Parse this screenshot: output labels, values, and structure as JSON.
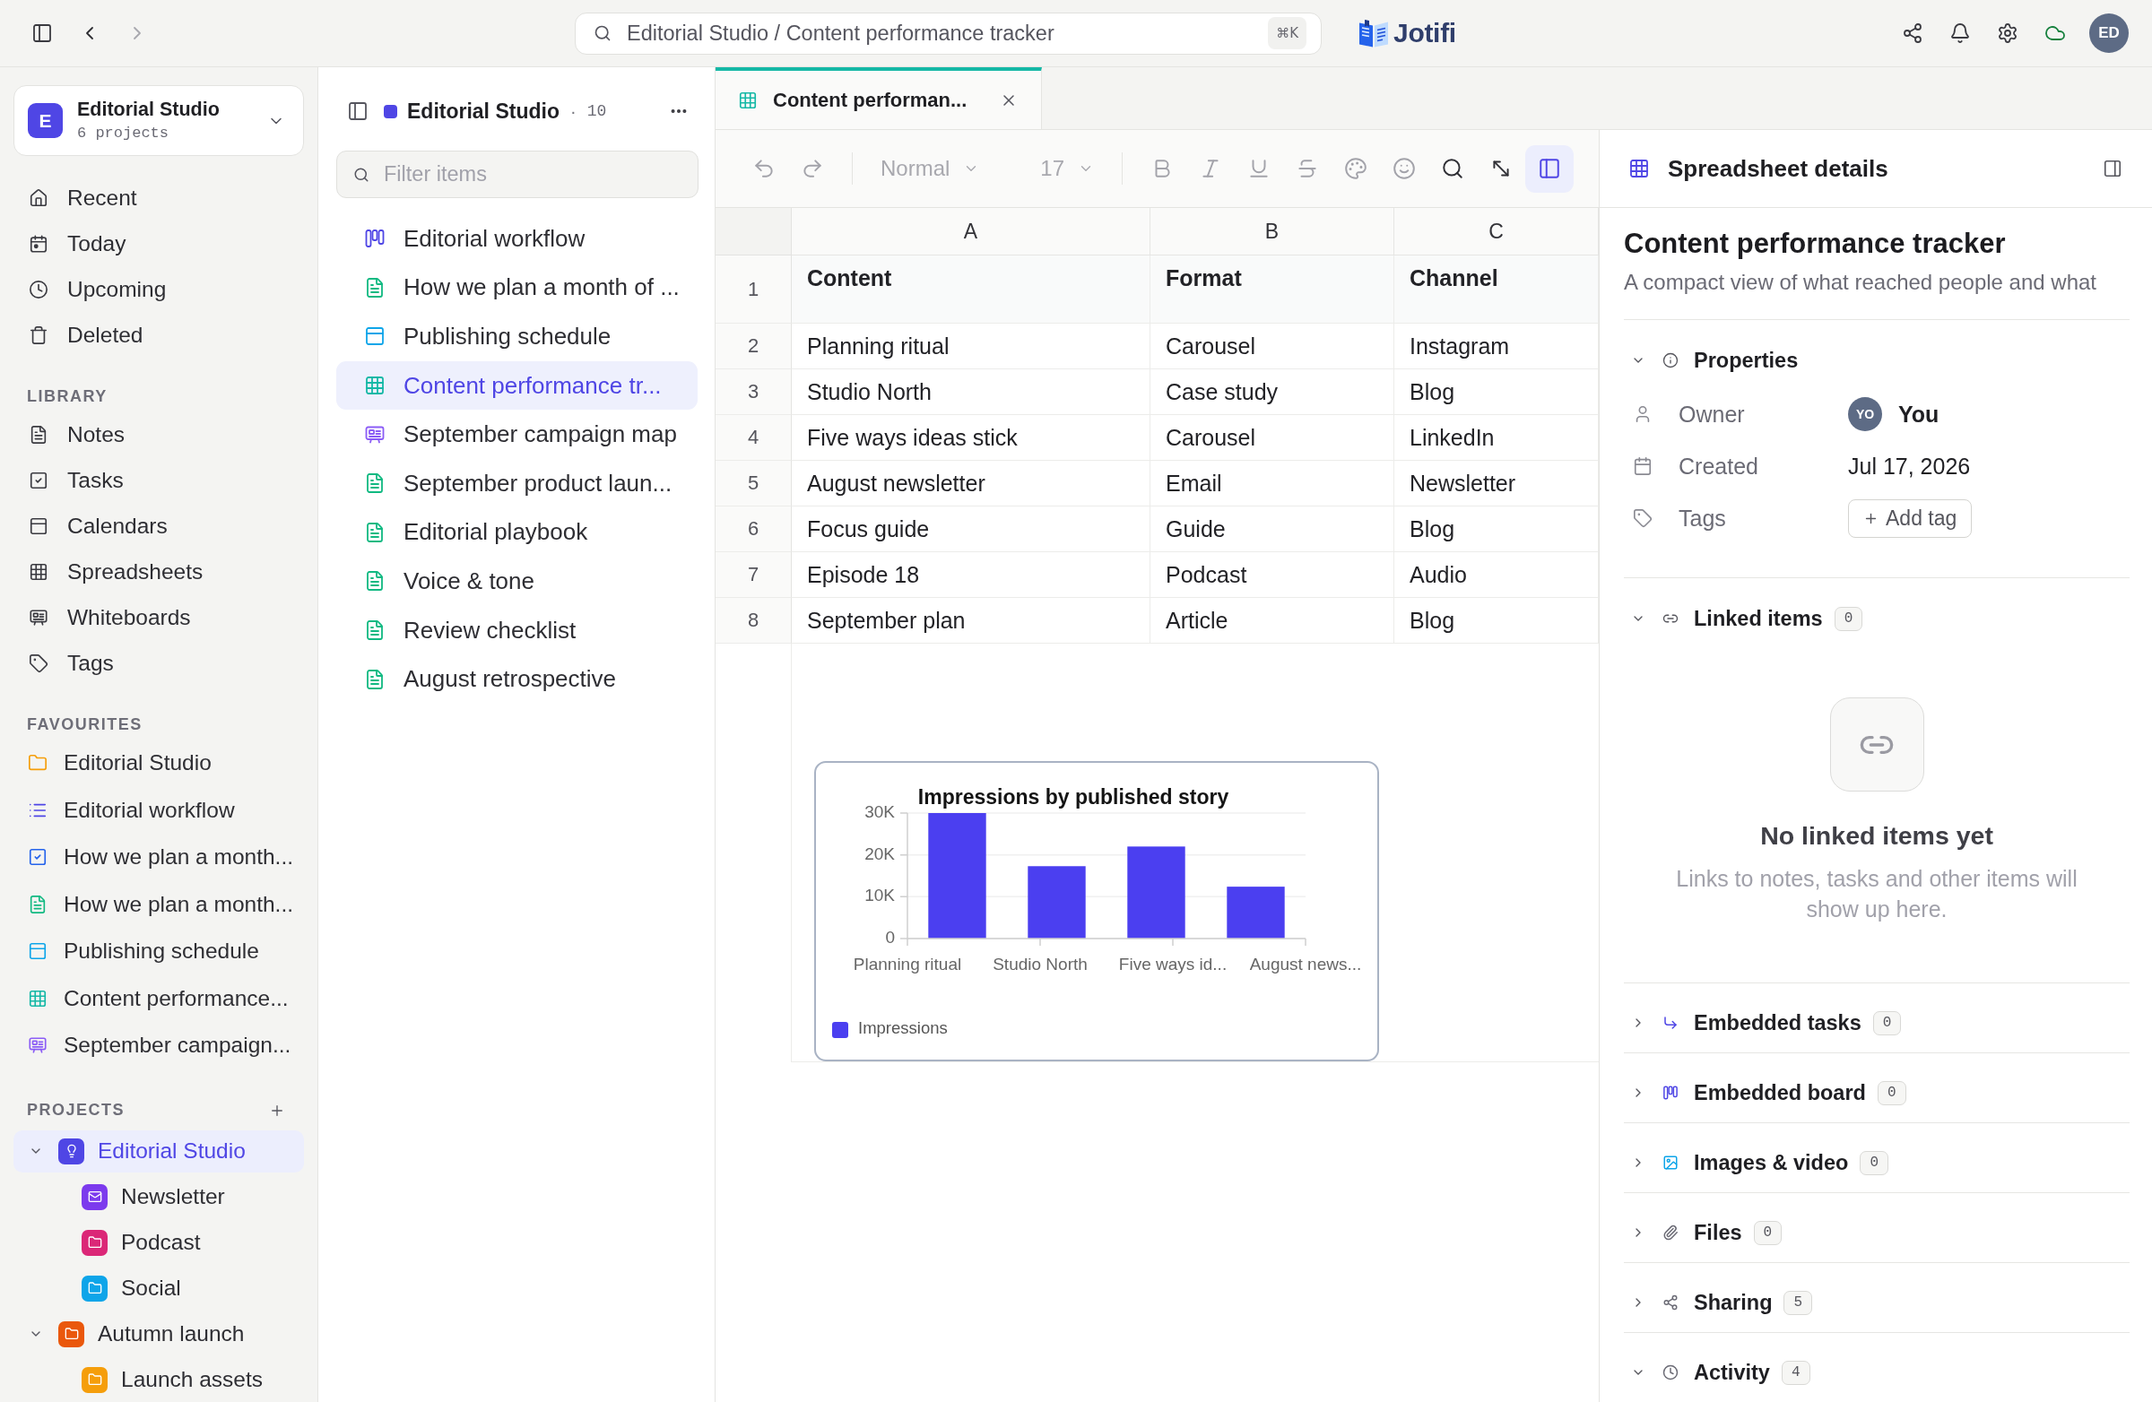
{
  "topbar": {
    "history": [
      {
        "kind": "back",
        "disabled": false
      },
      {
        "kind": "forward",
        "disabled": true
      }
    ],
    "search": {
      "value": "Editorial Studio / Content performance tracker",
      "shortcut": "⌘K"
    },
    "logo": "Jotifi",
    "avatar": "ED"
  },
  "sidebar": {
    "workspace": {
      "initial": "E",
      "name": "Editorial Studio",
      "subtitle": "6 projects"
    },
    "nav": [
      "Recent",
      "Today",
      "Upcoming",
      "Deleted"
    ],
    "library": {
      "title": "LIBRARY",
      "items": [
        "Notes",
        "Tasks",
        "Calendars",
        "Spreadsheets",
        "Whiteboards",
        "Tags"
      ]
    },
    "favourites": {
      "title": "FAVOURITES",
      "items": [
        {
          "label": "Editorial Studio",
          "kind": "folder"
        },
        {
          "label": "Editorial workflow",
          "kind": "list"
        },
        {
          "label": "How we plan a month...",
          "kind": "task"
        },
        {
          "label": "How we plan a month...",
          "kind": "note"
        },
        {
          "label": "Publishing schedule",
          "kind": "calendar"
        },
        {
          "label": "Content performance...",
          "kind": "spreadsheet"
        },
        {
          "label": "September campaign...",
          "kind": "whiteboard"
        }
      ]
    },
    "projects": {
      "title": "PROJECTS",
      "items": [
        {
          "label": "Editorial Studio",
          "kind": "idea",
          "color": "#4f46e5",
          "selected": true,
          "expanded": true,
          "children": [
            {
              "label": "Newsletter",
              "kind": "mail",
              "color": "#7c3aed",
              "selected": false
            },
            {
              "label": "Podcast",
              "kind": "folder",
              "color": "#db2777",
              "selected": false
            },
            {
              "label": "Social",
              "kind": "folder",
              "color": "#0ea5e9",
              "selected": false
            }
          ]
        },
        {
          "label": "Autumn launch",
          "kind": "folder",
          "color": "#ea580c",
          "selected": false,
          "expanded": true,
          "children": [
            {
              "label": "Launch assets",
              "kind": "folder",
              "color": "#f59e0b",
              "selected": false
            }
          ]
        }
      ]
    }
  },
  "collection": {
    "title": "Editorial Studio",
    "separator": "·",
    "count": "10",
    "filter": {
      "placeholder": "Filter items"
    },
    "items": [
      {
        "label": "Editorial workflow",
        "kind": "board",
        "selected": false
      },
      {
        "label": "How we plan a month of ...",
        "kind": "note",
        "selected": false
      },
      {
        "label": "Publishing schedule",
        "kind": "calendar",
        "selected": false
      },
      {
        "label": "Content performance tr...",
        "kind": "spreadsheet",
        "selected": true
      },
      {
        "label": "September campaign map",
        "kind": "whiteboard",
        "selected": false
      },
      {
        "label": "September product laun...",
        "kind": "note",
        "selected": false
      },
      {
        "label": "Editorial playbook",
        "kind": "note",
        "selected": false
      },
      {
        "label": "Voice & tone",
        "kind": "note",
        "selected": false
      },
      {
        "label": "Review checklist",
        "kind": "note",
        "selected": false
      },
      {
        "label": "August retrospective",
        "kind": "note",
        "selected": false
      }
    ]
  },
  "editor": {
    "tabs": [
      {
        "label": "Content performan...",
        "selected": true
      }
    ],
    "toolbar": {
      "history": [
        {
          "kind": "undo",
          "disabled": true
        },
        {
          "kind": "redo",
          "disabled": true
        }
      ],
      "style": {
        "value": "Normal",
        "disabled": true
      },
      "size": {
        "value": "17",
        "disabled": true
      },
      "tools": [
        {
          "kind": "bold",
          "disabled": true,
          "active": false
        },
        {
          "kind": "italic",
          "disabled": true,
          "active": false
        },
        {
          "kind": "underline",
          "disabled": true,
          "active": false
        },
        {
          "kind": "strikethrough",
          "disabled": true,
          "active": false
        },
        {
          "kind": "color",
          "disabled": true,
          "active": false
        },
        {
          "kind": "emoji",
          "disabled": true,
          "active": false
        },
        {
          "kind": "search",
          "disabled": false,
          "active": false
        },
        {
          "kind": "expand",
          "disabled": false,
          "active": false
        },
        {
          "kind": "panel",
          "disabled": false,
          "active": true
        }
      ]
    },
    "sheet": {
      "columns": [
        "A",
        "B",
        "C"
      ],
      "rows": [
        {
          "number": "1",
          "kind": "header",
          "cells": [
            "Content",
            "Format",
            "Channel"
          ]
        },
        {
          "number": "2",
          "kind": "data",
          "cells": [
            "Planning ritual",
            "Carousel",
            "Instagram"
          ]
        },
        {
          "number": "3",
          "kind": "data",
          "cells": [
            "Studio North",
            "Case study",
            "Blog"
          ]
        },
        {
          "number": "4",
          "kind": "data",
          "cells": [
            "Five ways ideas stick",
            "Carousel",
            "LinkedIn"
          ]
        },
        {
          "number": "5",
          "kind": "data",
          "cells": [
            "August newsletter",
            "Email",
            "Newsletter"
          ]
        },
        {
          "number": "6",
          "kind": "data",
          "cells": [
            "Focus guide",
            "Guide",
            "Blog"
          ]
        },
        {
          "number": "7",
          "kind": "data",
          "cells": [
            "Episode 18",
            "Podcast",
            "Audio"
          ]
        },
        {
          "number": "8",
          "kind": "data",
          "cells": [
            "September plan",
            "Article",
            "Blog"
          ]
        }
      ],
      "chart": {
        "chart_data": {
          "type": "bar",
          "title": "Impressions by published story",
          "categories": [
            "Planning ritual",
            "Studio North",
            "Five ways id...",
            "August news..."
          ],
          "series": [
            {
              "name": "Impressions",
              "color": "#4b3ff0",
              "values": [
                30000,
                17300,
                22000,
                12400
              ]
            }
          ],
          "ylim": [
            0,
            30000
          ],
          "yticks": [
            {
              "value": 0,
              "label": "0"
            },
            {
              "value": 10000,
              "label": "10K"
            },
            {
              "value": 20000,
              "label": "20K"
            },
            {
              "value": 30000,
              "label": "30K"
            }
          ]
        }
      }
    }
  },
  "details": {
    "header": "Spreadsheet details",
    "title": "Content performance tracker",
    "description": "A compact view of what reached people and what",
    "properties": {
      "label": "Properties",
      "expanded": true,
      "rows": [
        {
          "kind": "person",
          "label": "Owner",
          "avatar": "YO",
          "value": "You"
        },
        {
          "kind": "date",
          "label": "Created",
          "value": "Jul 17, 2026"
        },
        {
          "kind": "tags",
          "label": "Tags",
          "action": "Add tag"
        }
      ]
    },
    "linked": {
      "label": "Linked items",
      "count": "0",
      "expanded": true,
      "empty_title": "No linked items yet",
      "empty_text": "Links to notes, tasks and other items will show up here."
    },
    "sections": [
      {
        "kind": "tasks",
        "label": "Embedded tasks",
        "count": "0",
        "expanded": false
      },
      {
        "kind": "board",
        "label": "Embedded board",
        "count": "0",
        "expanded": false
      },
      {
        "kind": "media",
        "label": "Images & video",
        "count": "0",
        "expanded": false
      },
      {
        "kind": "files",
        "label": "Files",
        "count": "0",
        "expanded": false
      },
      {
        "kind": "sharing",
        "label": "Sharing",
        "count": "5",
        "expanded": false
      },
      {
        "kind": "activity",
        "label": "Activity",
        "count": "4",
        "expanded": true
      }
    ]
  }
}
